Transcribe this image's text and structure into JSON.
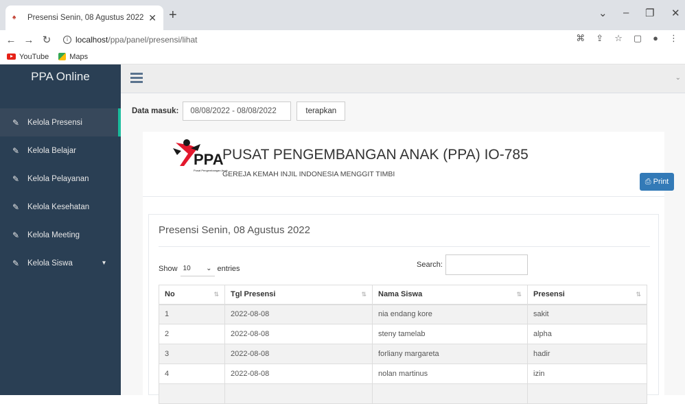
{
  "browser": {
    "tab_title": "Presensi Senin, 08 Agustus 2022",
    "url_host": "localhost",
    "url_path": "/ppa/panel/presensi/lihat",
    "bookmarks": [
      {
        "label": "YouTube",
        "icon": "youtube-icon"
      },
      {
        "label": "Maps",
        "icon": "maps-icon"
      }
    ]
  },
  "sidebar": {
    "brand": "PPA Online",
    "items": [
      {
        "label": "Kelola Presensi",
        "active": true
      },
      {
        "label": "Kelola Belajar"
      },
      {
        "label": "Kelola Pelayanan"
      },
      {
        "label": "Kelola Kesehatan"
      },
      {
        "label": "Kelola Meeting"
      },
      {
        "label": "Kelola Siswa",
        "has_submenu": true
      }
    ]
  },
  "filter": {
    "label": "Data masuk:",
    "date_range": "08/08/2022 - 08/08/2022",
    "apply_label": "terapkan"
  },
  "header": {
    "print_label": "Print",
    "logo_text": "PPA",
    "logo_tagline": "Pusat Pengembangan Anak",
    "org_name": "PUSAT PENGEMBANGAN ANAK (PPA) IO-785",
    "org_sub": "GEREJA KEMAH INJIL INDONESIA MENGGIT TIMBI"
  },
  "report": {
    "title": "Presensi Senin, 08 Agustus 2022",
    "show_label": "Show",
    "entries_value": "10",
    "entries_label": "entries",
    "search_label": "Search:",
    "columns": [
      "No",
      "Tgl Presensi",
      "Nama Siswa",
      "Presensi"
    ],
    "rows": [
      [
        "1",
        "2022-08-08",
        "nia endang kore",
        "sakit"
      ],
      [
        "2",
        "2022-08-08",
        "steny tamelab",
        "alpha"
      ],
      [
        "3",
        "2022-08-08",
        "forliany margareta",
        "hadir"
      ],
      [
        "4",
        "2022-08-08",
        "nolan martinus",
        "izin"
      ]
    ]
  },
  "colors": {
    "sidebar_bg": "#2a3f54",
    "accent": "#1abb9c",
    "print_button": "#337ab7"
  }
}
